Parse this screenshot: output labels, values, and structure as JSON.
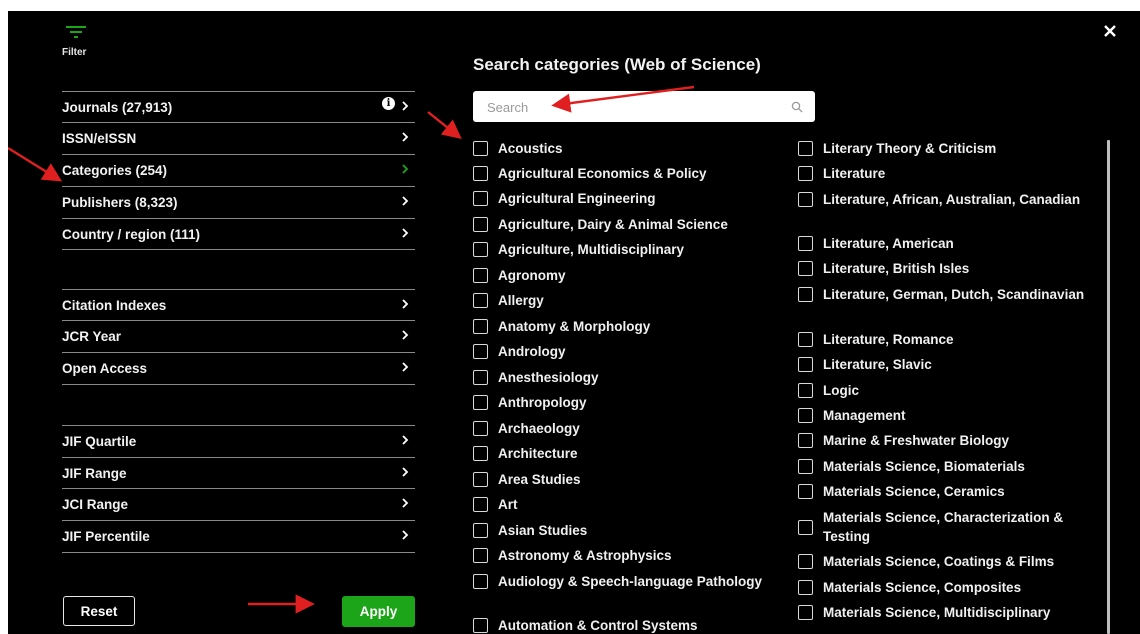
{
  "sidebar": {
    "filter_label": "Filter",
    "group1": [
      {
        "label": "Journals (27,913)"
      },
      {
        "label": "ISSN/eISSN"
      },
      {
        "label": "Categories (254)"
      },
      {
        "label": "Publishers (8,323)"
      },
      {
        "label": "Country / region (111)"
      }
    ],
    "group2": [
      {
        "label": "Citation Indexes"
      },
      {
        "label": "JCR Year"
      },
      {
        "label": "Open Access"
      }
    ],
    "group3": [
      {
        "label": "JIF Quartile"
      },
      {
        "label": "JIF Range"
      },
      {
        "label": "JCI Range"
      },
      {
        "label": "JIF Percentile"
      }
    ],
    "info_icon": "info-icon",
    "selected_chevron_color": "#1da51a"
  },
  "buttons": {
    "reset": "Reset",
    "apply": "Apply",
    "apply_color": "#1da51a"
  },
  "panel": {
    "title": "Search categories (Web of Science)",
    "search_placeholder": "Search"
  },
  "categories_left": [
    "Acoustics",
    "Agricultural Economics & Policy",
    "Agricultural Engineering",
    "Agriculture, Dairy & Animal Science",
    "Agriculture, Multidisciplinary",
    "Agronomy",
    "Allergy",
    "Anatomy & Morphology",
    "Andrology",
    "Anesthesiology",
    "Anthropology",
    "Archaeology",
    "Architecture",
    "Area Studies",
    "Art",
    "Asian Studies",
    "Astronomy & Astrophysics",
    "Audiology & Speech-language Pathology",
    "Automation & Control Systems"
  ],
  "categories_right": [
    "Literary Theory & Criticism",
    "Literature",
    "Literature, African, Australian, Canadian",
    "Literature, American",
    "Literature, British Isles",
    "Literature, German, Dutch, Scandinavian",
    "Literature, Romance",
    "Literature, Slavic",
    "Logic",
    "Management",
    "Marine & Freshwater Biology",
    "Materials Science, Biomaterials",
    "Materials Science, Ceramics",
    "Materials Science, Characterization & Testing",
    "Materials Science, Coatings & Films",
    "Materials Science, Composites",
    "Materials Science, Multidisciplinary"
  ],
  "annotation_color": "#e02020"
}
